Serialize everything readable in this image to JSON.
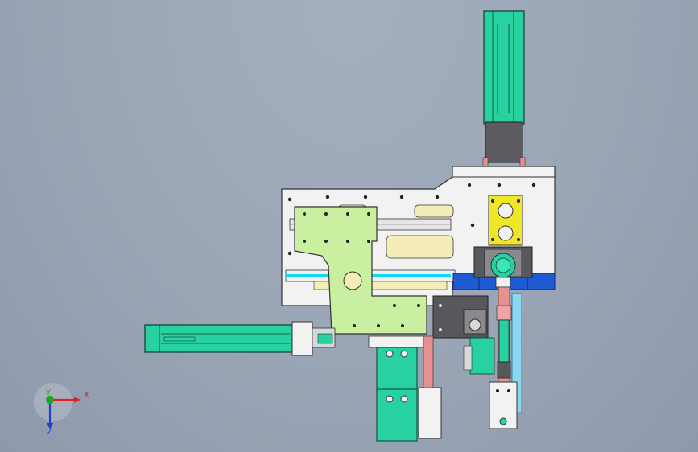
{
  "viewport": {
    "background": "#9ba6b5",
    "triad": {
      "x_label": "X",
      "y_label": "Y",
      "z_label": "Z",
      "x_color": "#e02020",
      "y_color": "#18a818",
      "z_color": "#2040d0"
    }
  },
  "model": {
    "colors": {
      "plate_white": "#f2f2f2",
      "plate_green": "#c8f0a0",
      "cylinder_teal": "#28d2a0",
      "bracket_gray": "#58585c",
      "base_blue": "#1e5ad2",
      "mount_yellow": "#f0e628",
      "rod_pink": "#e89090",
      "slot_cream": "#f5edb8",
      "cyan_strip": "#10d8f0"
    }
  }
}
